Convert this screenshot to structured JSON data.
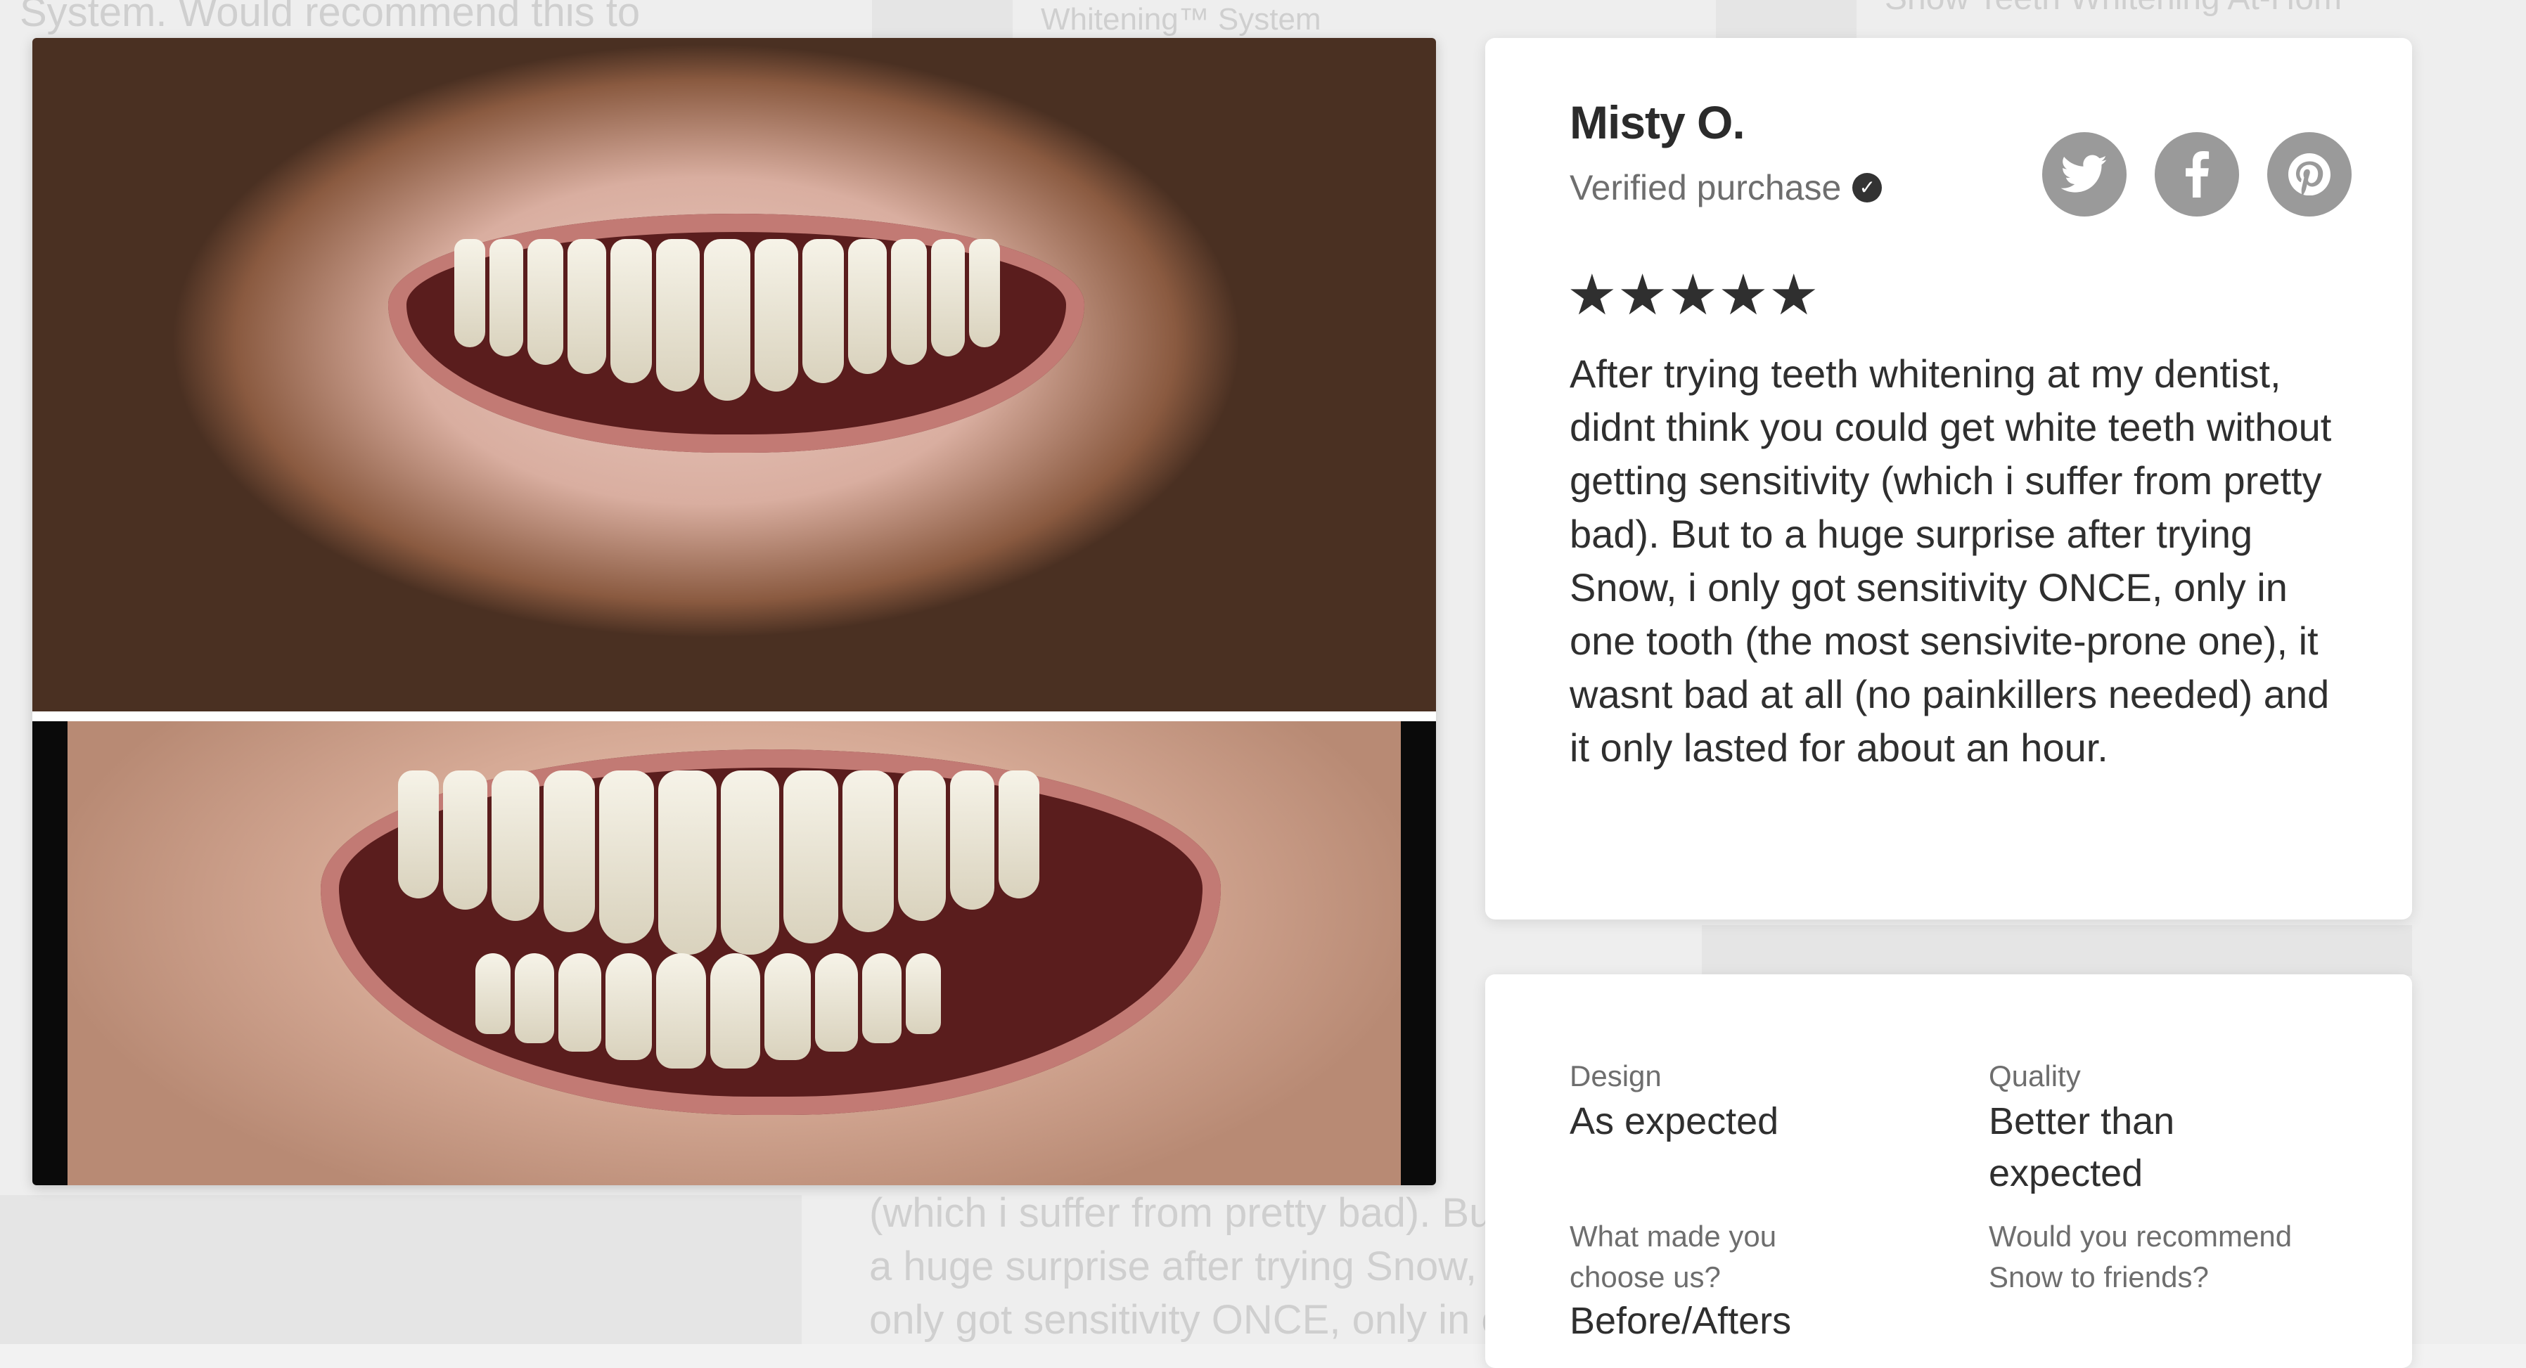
{
  "background": {
    "text_top_left": "System. Would recommend this to",
    "text_top_mid": "Whitening™ System",
    "text_top_right": "Snow Teeth Whitening    At-Hom",
    "text_bottom_lines": [
      "(which i suffer from pretty bad). But to",
      "a huge surprise after trying Snow, i",
      "only got sensitivity ONCE, only in one"
    ]
  },
  "photo": {
    "before_teeth": 13,
    "after_upper_teeth": 12,
    "after_lower_teeth": 10
  },
  "review": {
    "reviewer_name": "Misty O.",
    "verified_label": "Verified purchase",
    "rating": 5,
    "stars": "★★★★★",
    "body": "After trying teeth whitening at my dentist, didnt think you could get white teeth without getting sensitivity (which i suffer from pretty bad). But to a huge surprise after trying Snow, i only got sensitivity ONCE, only in one tooth (the most sensivite-prone one), it wasnt bad at all (no painkillers needed) and it only lasted for about an hour.",
    "share": {
      "twitter_icon": "twitter-icon",
      "facebook_icon": "facebook-icon",
      "pinterest_icon": "pinterest-icon"
    }
  },
  "details": {
    "design_label": "Design",
    "design_value": "As expected",
    "quality_label": "Quality",
    "quality_value": "Better than expected",
    "choose_label": "What made you choose us?",
    "choose_value": "Before/Afters",
    "recommend_label": "Would you recommend Snow to friends?"
  }
}
